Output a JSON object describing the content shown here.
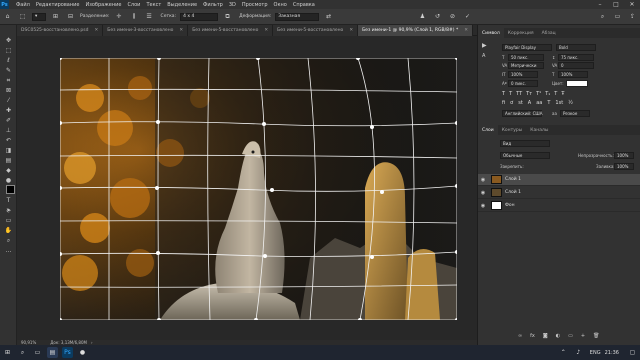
{
  "menu": {
    "app_icon": "Ps",
    "items": [
      "Файл",
      "Редактирование",
      "Изображение",
      "Слои",
      "Текст",
      "Выделение",
      "Фильтр",
      "3D",
      "Просмотр",
      "Окно",
      "Справка"
    ],
    "window_controls": {
      "minimize": "–",
      "maximize": "□",
      "close": "✕"
    }
  },
  "options": {
    "mode_label": "Разделение:",
    "mode_value": "",
    "grid_label": "Сетка:",
    "grid_value": "4 x 4",
    "deform_label": "Деформация:",
    "deform_value": "Заказная"
  },
  "tabs": [
    {
      "label": "DSC0525-восстановлено.psd",
      "active": false
    },
    {
      "label": "Без имени-3-восстановлено",
      "active": false
    },
    {
      "label": "Без имени-5-восстановлено",
      "active": false
    },
    {
      "label": "Без имени-5-восстановлено",
      "active": false
    },
    {
      "label": "Без имени-1 @ 90,9% (Слой 1, RGB/8#) *",
      "active": true
    }
  ],
  "status": {
    "zoom": "90,91%",
    "doc": "Док: 3,13М/6,80М"
  },
  "char_panel": {
    "tabs": [
      "Символ",
      "Коррекция",
      "Абзац"
    ],
    "font": "Playfair Display",
    "style": "Bold",
    "size": "50 пикс.",
    "leading": "75 пикс.",
    "kerning": "Метрически",
    "tracking": "0",
    "scale_v": "100%",
    "scale_h": "100%",
    "baseline": "0 пикс.",
    "color_label": "Цвет:",
    "language": "Английский: США",
    "aa": "Резкое"
  },
  "layers_panel": {
    "tabs": [
      "Слои",
      "Контуры",
      "Каналы"
    ],
    "search_placeholder": "Вид",
    "blend_mode": "Обычные",
    "opacity_label": "Непрозрачность:",
    "opacity": "100%",
    "lock_label": "Закрепить:",
    "fill_label": "Заливка:",
    "fill": "100%",
    "layers": [
      {
        "name": "Слой 1",
        "visible": true,
        "selected": true
      },
      {
        "name": "Слой 1",
        "visible": true,
        "selected": false
      },
      {
        "name": "Фон",
        "visible": true,
        "selected": false
      }
    ]
  },
  "taskbar": {
    "lang": "ENG",
    "time": "21:36"
  },
  "colors": {
    "accent": "#31a8ff",
    "active_tab": "#454545",
    "image_orange": "#d17f1a"
  }
}
